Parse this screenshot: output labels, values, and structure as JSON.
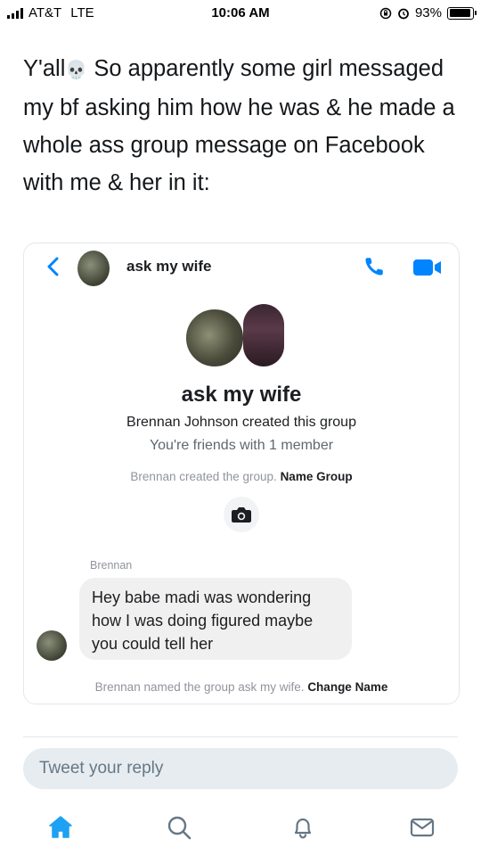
{
  "status_bar": {
    "carrier": "AT&T",
    "network": "LTE",
    "time": "10:06 AM",
    "battery_percent": "93%",
    "battery_level": 0.93
  },
  "tweet": {
    "text_before_emoji": "Y'all",
    "emoji": "💀",
    "text_after_emoji": " So apparently some girl messaged my bf asking him how he was & he made a whole ass group message on Facebook with me & her in it:"
  },
  "messenger": {
    "header_title": "ask my wife",
    "group_name": "ask my wife",
    "created_by": "Brennan Johnson created this group",
    "friends_line": "You're friends with 1 member",
    "sys_created_text": "Brennan created the group.",
    "sys_created_link": "Name Group",
    "sender": "Brennan",
    "message": "Hey babe madi was wondering how I was doing figured maybe you could tell her",
    "sys_named_text": "Brennan named the group ask my wife.",
    "sys_named_link": "Change Name",
    "icons": [
      "back-arrow-icon",
      "phone-icon",
      "video-camera-icon",
      "camera-icon"
    ],
    "accent_color": "#0084ff"
  },
  "reply": {
    "placeholder": "Tweet your reply"
  },
  "bottom_nav": {
    "items": [
      "home-icon",
      "search-icon",
      "notifications-icon",
      "messages-icon"
    ],
    "active": "home-icon",
    "active_color": "#1da1f2",
    "inactive_color": "#657786"
  }
}
